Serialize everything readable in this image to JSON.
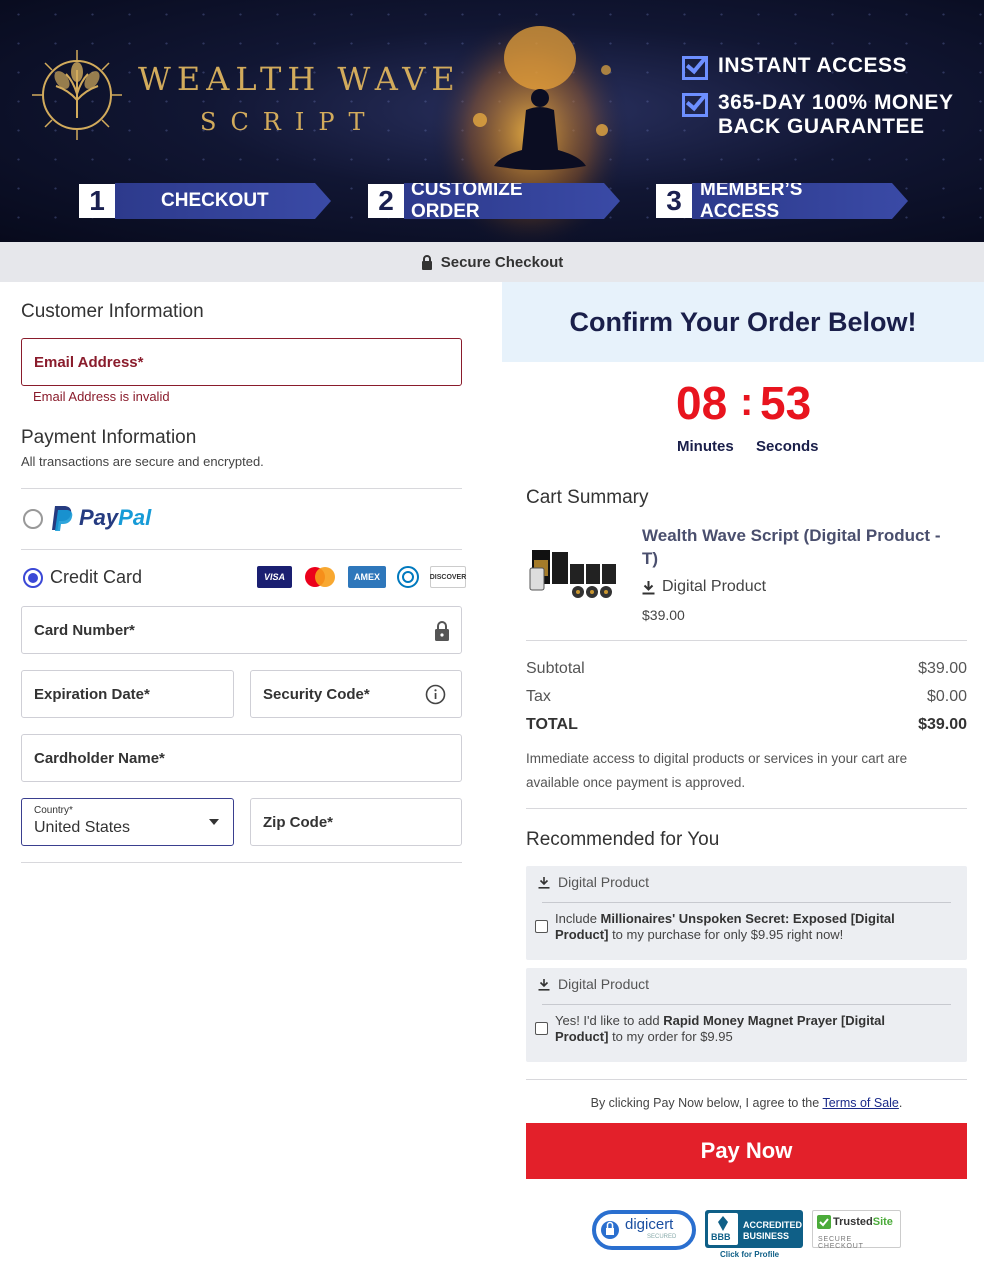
{
  "brand": {
    "line1": "WEALTH WAVE",
    "line2": "SCRIPT"
  },
  "guarantees": [
    "INSTANT ACCESS",
    "365-DAY 100% MONEY",
    "BACK GUARANTEE"
  ],
  "steps": [
    {
      "num": "1",
      "label": "CHECKOUT"
    },
    {
      "num": "2",
      "label": "CUSTOMIZE ORDER"
    },
    {
      "num": "3",
      "label": "MEMBER’S ACCESS"
    }
  ],
  "secure_checkout": "Secure Checkout",
  "customer": {
    "title": "Customer Information",
    "email_placeholder": "Email Address*",
    "email_error": "Email Address is invalid"
  },
  "payment": {
    "title": "Payment Information",
    "subtitle": "All transactions are secure and encrypted.",
    "paypal_label": "PayPal",
    "credit_card_label": "Credit Card",
    "card_logos": [
      "VISA",
      "AMEX",
      "DISCOVER"
    ],
    "card_number": "Card Number*",
    "expiration": "Expiration Date*",
    "security_code": "Security Code*",
    "cardholder": "Cardholder Name*",
    "country_label": "Country*",
    "country_value": "United States",
    "zip": "Zip Code*"
  },
  "order": {
    "confirm_title": "Confirm Your Order Below!",
    "timer_minutes": "08",
    "timer_seconds": "53",
    "timer_minutes_label": "Minutes",
    "timer_seconds_label": "Seconds",
    "cart_title": "Cart Summary",
    "product_name_1": "Wealth Wave Script (Digital Product -",
    "product_name_2": "T)",
    "product_type": "Digital Product",
    "product_price": "$39.00",
    "subtotal_label": "Subtotal",
    "subtotal_value": "$39.00",
    "tax_label": "Tax",
    "tax_value": "$0.00",
    "total_label": "TOTAL",
    "total_value": "$39.00",
    "access_note": "Immediate access to digital products or services in your cart are available once payment is approved.",
    "recommended_title": "Recommended for You",
    "rec1": {
      "type": "Digital Product",
      "pre": "Include ",
      "bold": "Millionaires' Unspoken Secret: Exposed [Digital Product]",
      "post": " to my purchase for only $9.95 right now!"
    },
    "rec2": {
      "type": "Digital Product",
      "pre": "Yes! I'd like to add ",
      "bold": "Rapid Money Magnet Prayer [Digital Product]",
      "post": " to my order for $9.95"
    },
    "terms_pre": "By clicking Pay Now below, I agree to the ",
    "terms_link": "Terms of Sale",
    "terms_post": ".",
    "pay_button": "Pay Now"
  },
  "trust": {
    "digicert": "digicert",
    "digicert_sub": "SECURED",
    "bbb_1": "ACCREDITED",
    "bbb_2": "BUSINESS",
    "bbb_logo": "BBB",
    "bbb_sub": "Click for Profile",
    "trusted_1": "Trusted",
    "trusted_2": "Site",
    "trusted_sub": "SECURE CHECKOUT"
  },
  "colors": {
    "accent": "#3b48d6",
    "error": "#8a1c2c",
    "pay_button": "#e3202a",
    "timer": "#e8141e",
    "heading_navy": "#1a1f4a"
  }
}
